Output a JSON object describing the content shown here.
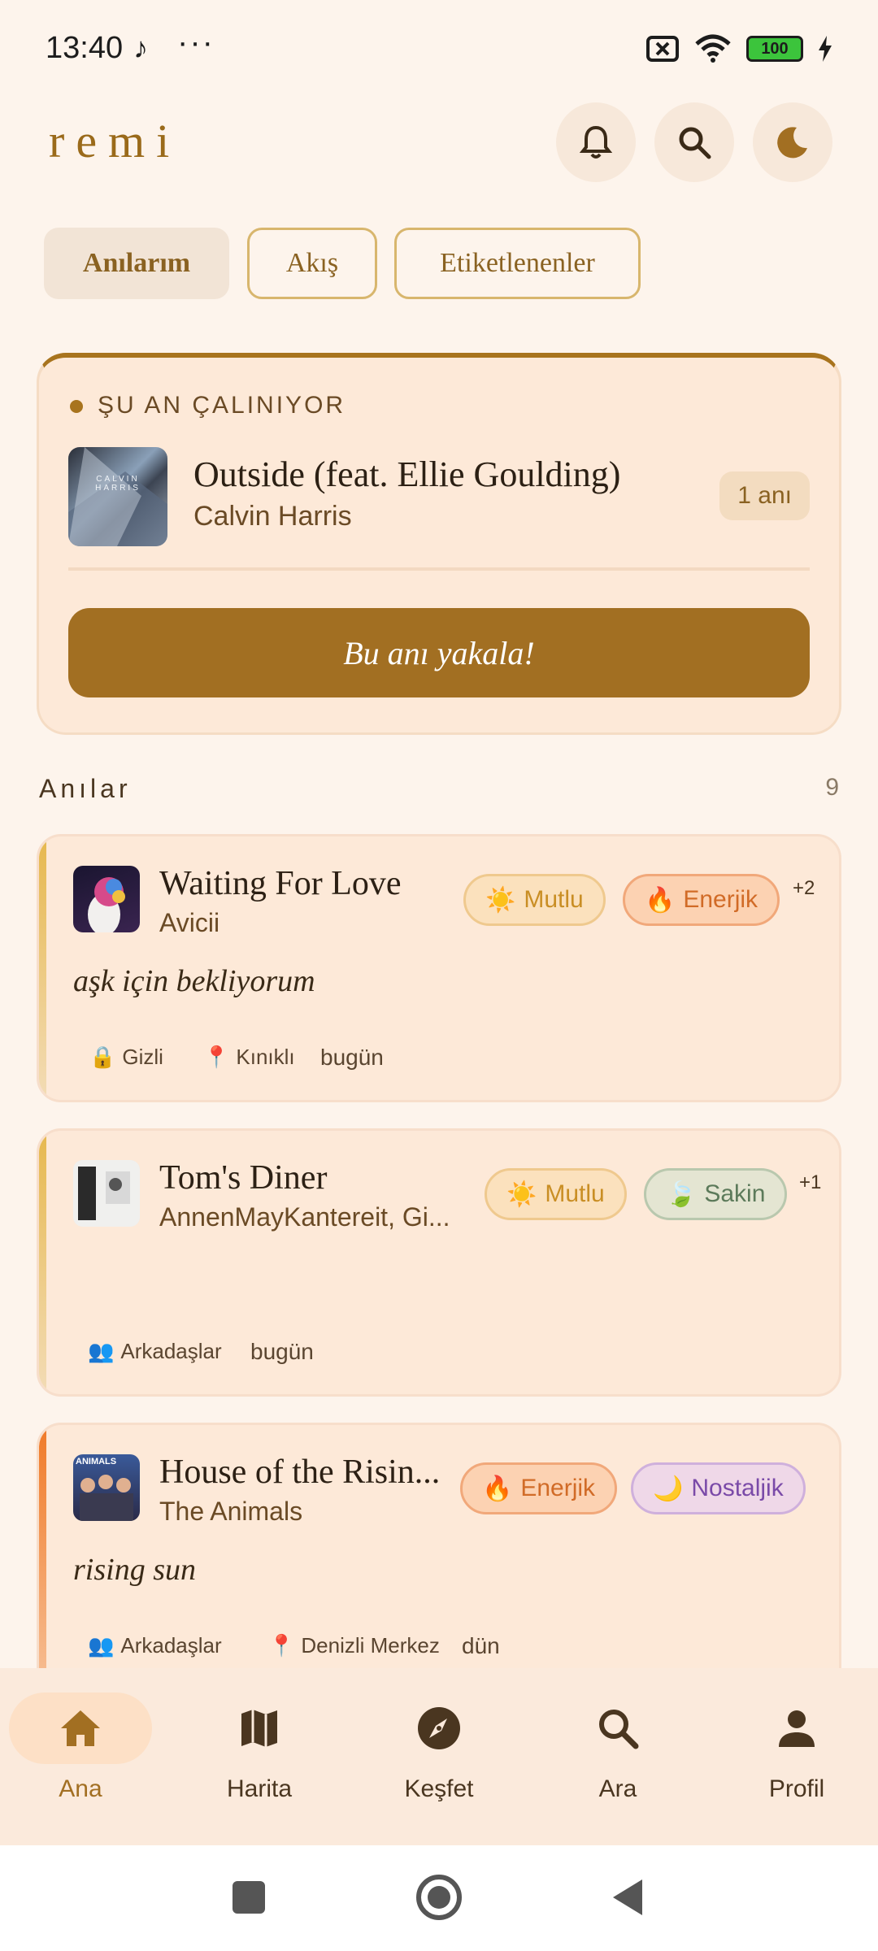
{
  "status_bar": {
    "time": "13:40",
    "note_icon": "♪",
    "more": "···",
    "battery": "100"
  },
  "header": {
    "logo": "remi"
  },
  "tabs": [
    {
      "label": "Anılarım"
    },
    {
      "label": "Akış"
    },
    {
      "label": "Etiketlenenler"
    }
  ],
  "now_playing": {
    "label": "ŞU AN ÇALINIYOR",
    "title": "Outside (feat. Ellie Goulding)",
    "artist": "Calvin Harris",
    "badge": "1 anı",
    "cta": "Bu anı yakala!",
    "art_text": "CALVIN HARRIS"
  },
  "memories_section": {
    "title": "Anılar",
    "count": "9"
  },
  "memories": [
    {
      "title": "Waiting For Love",
      "artist": "Avicii",
      "chips": [
        {
          "emoji": "☀️",
          "label": "Mutlu"
        },
        {
          "emoji": "🔥",
          "label": "Enerjik"
        }
      ],
      "more": "+2",
      "note": "aşk için bekliyorum",
      "privacy": "Gizli",
      "location": "Kınıklı",
      "time": "bugün"
    },
    {
      "title": "Tom's Diner",
      "artist": "AnnenMayKantereit, Gi...",
      "chips": [
        {
          "emoji": "☀️",
          "label": "Mutlu"
        },
        {
          "emoji": "🍃",
          "label": "Sakin"
        }
      ],
      "more": "+1",
      "note": "",
      "privacy": "Arkadaşlar",
      "location": "",
      "time": "bugün"
    },
    {
      "title": "House of the Risin...",
      "artist": "The Animals",
      "chips": [
        {
          "emoji": "🔥",
          "label": "Enerjik"
        },
        {
          "emoji": "🌙",
          "label": "Nostaljik"
        }
      ],
      "more": "",
      "note": "rising sun",
      "privacy": "Arkadaşlar",
      "location": "Denizli Merkez",
      "time": "dün",
      "art_text": "ANIMALS"
    }
  ],
  "bottom_nav": [
    {
      "label": "Ana",
      "icon": "home-icon"
    },
    {
      "label": "Harita",
      "icon": "map-icon"
    },
    {
      "label": "Keşfet",
      "icon": "compass-icon"
    },
    {
      "label": "Ara",
      "icon": "search-icon"
    },
    {
      "label": "Profil",
      "icon": "person-icon"
    }
  ],
  "colors": {
    "accent": "#a26f22",
    "background": "#fdf4ec",
    "card": "#fde9d8"
  }
}
